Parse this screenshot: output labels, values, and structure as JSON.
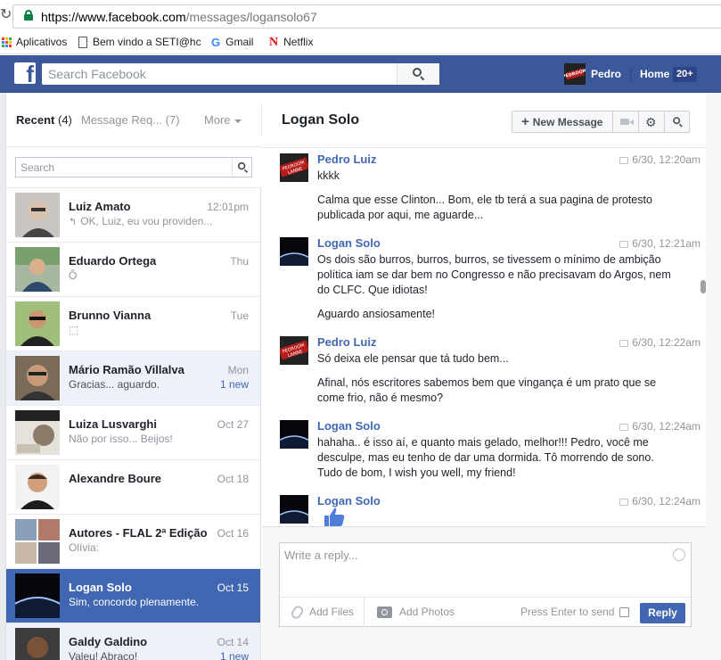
{
  "browser": {
    "url_host": "https://www.facebook.com",
    "url_path": "/messages/logansolo67",
    "bookmarks": [
      {
        "label": "Aplicativos",
        "icon": "apps-grid-icon"
      },
      {
        "label": "Bem vindo a SETI@hc",
        "icon": "page-icon"
      },
      {
        "label": "Gmail",
        "icon": "google-g-icon"
      },
      {
        "label": "Netflix",
        "icon": "netflix-n-icon"
      }
    ]
  },
  "fbbar": {
    "search_placeholder": "Search Facebook",
    "user_name": "Pedro",
    "home_label": "Home",
    "home_badge": "20+"
  },
  "left": {
    "recent_label": "Recent",
    "recent_count": "(4)",
    "requests_label": "Message Req... (7)",
    "more_label": "More",
    "search_placeholder": "Search",
    "conversations": [
      {
        "name": "Luiz Amato",
        "snippet": "OK, Luiz, eu vou providen...",
        "time": "12:01pm",
        "replied": true,
        "state": "read"
      },
      {
        "name": "Eduardo Ortega",
        "snippet": "Ô",
        "time": "Thu",
        "state": "read"
      },
      {
        "name": "Brunno Vianna",
        "snippet": "⬚",
        "time": "Tue",
        "state": "read"
      },
      {
        "name": "Mário Ramão Villalva",
        "snippet": "Gracias... aguardo.",
        "time": "Mon",
        "new": "1 new",
        "state": "unread"
      },
      {
        "name": "Luiza Lusvarghi",
        "snippet": "Não por isso... Beijos!",
        "time": "Oct 27",
        "state": "read"
      },
      {
        "name": "Alexandre Boure",
        "snippet": "",
        "time": "Oct 18",
        "state": "read"
      },
      {
        "name": "Autores - FLAL 2ª Edição",
        "snippet": "Olívia:",
        "time": "Oct 16",
        "state": "read"
      },
      {
        "name": "Logan Solo",
        "snippet": "Sim, concordo plenamente.",
        "time": "Oct 15",
        "state": "selected"
      },
      {
        "name": "Galdy Galdino",
        "snippet": "Valeu! Abraço!",
        "time": "Oct 14",
        "new": "1 new",
        "state": "unread"
      }
    ]
  },
  "right": {
    "title": "Logan Solo",
    "new_message_label": "New Message",
    "messages": [
      {
        "from": "Pedro Luiz",
        "time": "6/30, 12:20am",
        "paragraphs": [
          "kkkk",
          "Calma que esse Clinton... Bom, ele tb terá a sua pagina de protesto publicada por aqui, me aguarde..."
        ]
      },
      {
        "from": "Logan Solo",
        "time": "6/30, 12:21am",
        "paragraphs": [
          "Os  dois são burros, burros, burros, se tivessem o mínimo de ambição política iam se dar bem no Congresso e não precisavam do Argos, nem do CLFC. Que idiotas!",
          "Aguardo ansiosamente!"
        ]
      },
      {
        "from": "Pedro Luiz",
        "time": "6/30, 12:22am",
        "paragraphs": [
          "Só deixa ele pensar que tá tudo bem...",
          "Afinal, nós escritores sabemos bem que vingança é um prato que se come frio, não é mesmo?"
        ]
      },
      {
        "from": "Logan Solo",
        "time": "6/30, 12:24am",
        "paragraphs": [
          "hahaha.. é isso aí, e quanto mais gelado, melhor!!! Pedro, você me desculpe, mas eu tenho de dar uma dormida. Tô morrendo de sono. Tudo de bom, I wish you well, my friend!"
        ]
      },
      {
        "from": "Logan Solo",
        "time": "6/30, 12:24am",
        "paragraphs": []
      }
    ],
    "composer": {
      "placeholder": "Write a reply...",
      "add_files": "Add Files",
      "add_photos": "Add Photos",
      "press_enter": "Press Enter to send",
      "reply_label": "Reply"
    }
  },
  "colors": {
    "fb_blue": "#3b5998",
    "selected_row": "#4267b2",
    "unread_row": "#edf2fa",
    "link_blue": "#4267b2"
  }
}
